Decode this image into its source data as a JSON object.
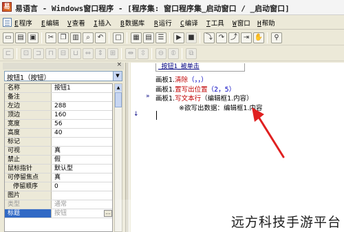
{
  "window": {
    "title": "易语言 - Windows窗口程序 - [程序集: 窗口程序集_启动窗口 / _启动窗口]"
  },
  "menubar": {
    "items": [
      {
        "key": "E",
        "label": "程序"
      },
      {
        "key": "E",
        "label": "编辑"
      },
      {
        "key": "V",
        "label": "查看"
      },
      {
        "key": "I",
        "label": "插入"
      },
      {
        "key": "B",
        "label": "数据库"
      },
      {
        "key": "R",
        "label": "运行"
      },
      {
        "key": "C",
        "label": "编译"
      },
      {
        "key": "T",
        "label": "工具"
      },
      {
        "key": "W",
        "label": "窗口"
      },
      {
        "key": "H",
        "label": "帮助"
      }
    ]
  },
  "property_panel": {
    "object_selector": "按钮1（按钮）",
    "rows": [
      {
        "name": "名称",
        "value": "按钮1"
      },
      {
        "name": "备注",
        "value": ""
      },
      {
        "name": "左边",
        "value": "288"
      },
      {
        "name": "顶边",
        "value": "160"
      },
      {
        "name": "宽度",
        "value": "56"
      },
      {
        "name": "高度",
        "value": "40"
      },
      {
        "name": "标记",
        "value": ""
      },
      {
        "name": "可视",
        "value": "真"
      },
      {
        "name": "禁止",
        "value": "假"
      },
      {
        "name": "鼠标指针",
        "value": "默认型"
      },
      {
        "name": "可停留焦点",
        "value": "真"
      },
      {
        "name": "停留顺序",
        "value": "0"
      },
      {
        "name": "图片",
        "value": ""
      },
      {
        "name": "类型",
        "value": "通常"
      },
      {
        "name": "标题",
        "value": "按钮"
      }
    ]
  },
  "editor": {
    "subroutine": "_按钮1_被单击",
    "lines": [
      {
        "obj": "画板1.",
        "cmd": "清除",
        "args": "（，，）"
      },
      {
        "obj": "画板1.",
        "cmd": "置写出位置",
        "args": "（2，5）"
      },
      {
        "obj": "画板1.",
        "cmd": "写文本行",
        "args": "（编辑框1.内容）"
      }
    ],
    "tooltip": "※欲写出数据：编辑框1.内容"
  },
  "watermark": "远方科技手游平台",
  "colors": {
    "command": "#c00000",
    "punctuation": "#0000c0",
    "arrow": "#e02020",
    "selection": "#316ac5"
  }
}
